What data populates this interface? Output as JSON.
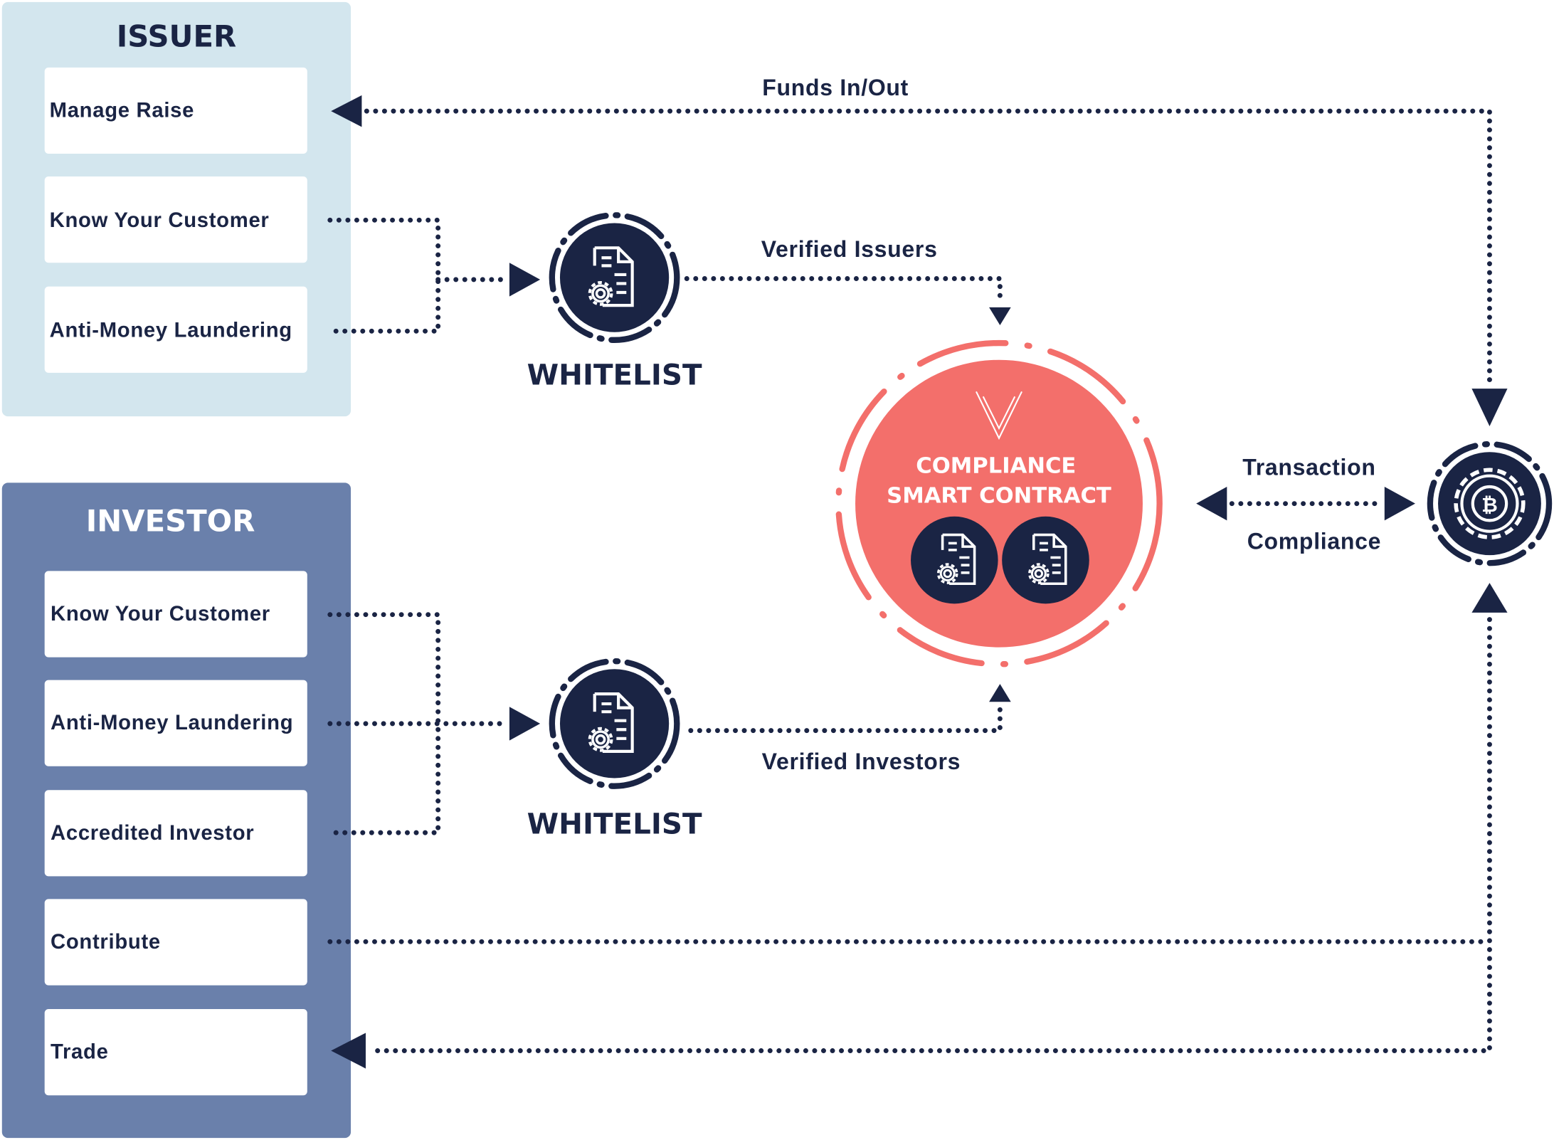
{
  "colors": {
    "issuer_panel": "#d3e6ee",
    "investor_panel": "#6a80ab",
    "navy": "#1a2444",
    "coral": "#f36f6b"
  },
  "issuer": {
    "title": "ISSUER",
    "items": [
      "Manage Raise",
      "Know Your Customer",
      "Anti-Money Laundering"
    ]
  },
  "investor": {
    "title": "INVESTOR",
    "items": [
      "Know Your Customer",
      "Anti-Money Laundering",
      "Accredited Investor",
      "Contribute",
      "Trade"
    ]
  },
  "whitelist_issuer": {
    "label": "WHITELIST",
    "icon": "document-gear-icon"
  },
  "whitelist_investor": {
    "label": "WHITELIST",
    "icon": "document-gear-icon"
  },
  "contract": {
    "line1": "COMPLIANCE",
    "line2": "SMART CONTRACT",
    "icon": "document-gear-icon"
  },
  "blockchain": {
    "icon": "bitcoin-gear-icon"
  },
  "flows": {
    "funds": "Funds In/Out",
    "verified_issuers": "Verified Issuers",
    "verified_investors": "Verified Investors",
    "transaction": "Transaction",
    "compliance": "Compliance"
  }
}
